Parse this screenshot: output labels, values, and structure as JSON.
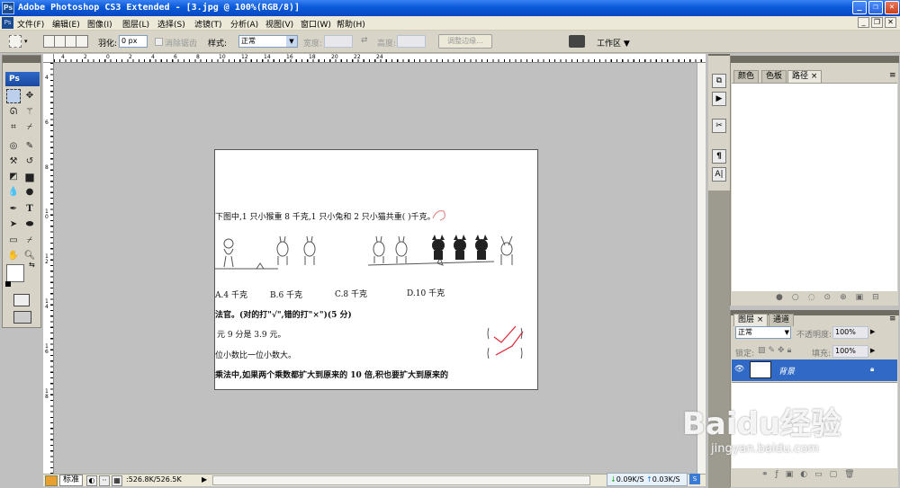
{
  "title_bar": {
    "title": "Adobe Photoshop CS3 Extended - [3.jpg @ 100%(RGB/8)]",
    "app_badge": "Ps"
  },
  "menu_bar": {
    "items": [
      "文件(F)",
      "编辑(E)",
      "图像(I)",
      "图层(L)",
      "选择(S)",
      "滤镜(T)",
      "分析(A)",
      "视图(V)",
      "窗口(W)",
      "帮助(H)"
    ]
  },
  "options_bar": {
    "feather_label": "羽化:",
    "feather_value": "0 px",
    "antialias_label": "消除锯齿",
    "style_label": "样式:",
    "style_value": "正常",
    "width_label": "宽度:",
    "height_label": "高度:",
    "refine_edge_label": "调整边缘...",
    "workspace_label": "工作区"
  },
  "toolbox": {
    "logo": "Ps"
  },
  "rulers": {
    "top": [
      "4",
      "2",
      "0",
      "2",
      "4",
      "6",
      "8",
      "10",
      "12",
      "14",
      "16",
      "18",
      "20",
      "22",
      "24"
    ],
    "left": [
      "4",
      "6",
      "8",
      "1\n0",
      "1\n2",
      "1\n4",
      "1\n6",
      "1\n8"
    ]
  },
  "document": {
    "line1": "下图中,1 只小猴重 8 千克,1 只小兔和 2 只小猫共重(      )千克。",
    "options": [
      "A.4 千克",
      "B.6 千克",
      "C.8 千克",
      "D.10 千克"
    ],
    "section": "法官。(对的打\"√\",错的打\"×\")(5 分)",
    "q1": "元 9 分是 3.9 元。",
    "q2": "位小数比一位小数大。",
    "q3": "乘法中,如果两个乘数都扩大到原来的 10 倍,积也要扩大到原来的"
  },
  "status_bar": {
    "mode_label": "标准",
    "doc_size": "526.8K/526.5K",
    "down_speed": "0.09K/S",
    "up_speed": "0.03K/S"
  },
  "panel_paths": {
    "tabs": [
      "颜色",
      "色板",
      "路径"
    ]
  },
  "panel_layers": {
    "tabs": [
      "图层",
      "通道"
    ],
    "blend_mode": "正常",
    "opacity_label": "不透明度:",
    "opacity_value": "100%",
    "lock_label": "锁定:",
    "fill_label": "填充:",
    "fill_value": "100%",
    "layer_name": "背景"
  },
  "watermark": {
    "brand": "Baidu经验",
    "url": "jingyan.baidu.com"
  },
  "colors": {
    "titlebar": "#0a5ad8",
    "selected_layer": "#3169c6",
    "workspace_bg": "#c0c0c0"
  }
}
